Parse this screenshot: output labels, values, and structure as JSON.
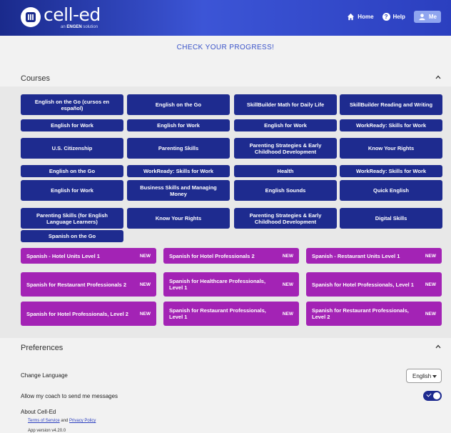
{
  "header": {
    "logo_name": "cell-ed",
    "logo_sub_prefix": "an",
    "logo_sub_brand": "ENGEN",
    "logo_sub_suffix": "solution",
    "nav": {
      "home": "Home",
      "help": "Help",
      "me": "Me"
    },
    "colors": {
      "bar_start": "#1a2a8c",
      "bar_end": "#3c55d6"
    }
  },
  "page_title": "CHECK YOUR PROGRESS!",
  "courses_section": {
    "title": "Courses",
    "courses": [
      "English on the Go (cursos en español)",
      "English on the Go",
      "SkillBuilder Math for Daily Life",
      "SkillBuilder Reading and Writing",
      "English for Work",
      "English for Work",
      "English for Work",
      "WorkReady: Skills for Work",
      "U.S. Citizenship",
      "Parenting Skills",
      "Parenting Strategies & Early Childhood Development",
      "Know Your Rights",
      "English on the Go",
      "WorkReady: Skills for Work",
      "Health",
      "WorkReady: Skills for Work",
      "English for Work",
      "Business Skills and Managing Money",
      "English Sounds",
      "Quick English",
      "Parenting Skills (for English Language Learners)",
      "Know Your Rights",
      "Parenting Strategies & Early Childhood Development",
      "Digital Skills",
      "Spanish on the Go"
    ],
    "new_courses": [
      {
        "name": "Spanish - Hotel Units Level 1",
        "badge": "NEW"
      },
      {
        "name": "Spanish for Hotel Professionals 2",
        "badge": "NEW"
      },
      {
        "name": "Spanish - Restaurant Units Level 1",
        "badge": "NEW"
      },
      {
        "name": "Spanish for Restaurant Professionals 2",
        "badge": "NEW"
      },
      {
        "name": "Spanish for Healthcare Professionals, Level 1",
        "badge": "NEW"
      },
      {
        "name": "Spanish for Hotel Professionals, Level 1",
        "badge": "NEW"
      },
      {
        "name": "Spanish for Hotel Professionals, Level 2",
        "badge": "NEW"
      },
      {
        "name": "Spanish for Restaurant Professionals, Level 1",
        "badge": "NEW"
      },
      {
        "name": "Spanish for Restaurant Professionals, Level 2",
        "badge": "NEW"
      }
    ],
    "colors": {
      "course": "#1e2b8f",
      "new_course": "#a323b5"
    }
  },
  "preferences_section": {
    "title": "Preferences",
    "change_language_label": "Change Language",
    "language_value": "English",
    "coach_messages_label": "Allow my coach to send me messages",
    "coach_messages_enabled": true,
    "about_label": "About Cell-Ed",
    "terms_link": "Terms of Service",
    "and_text": "and",
    "privacy_link": "Privacy Policy",
    "app_version": "App version v4.20.0"
  }
}
